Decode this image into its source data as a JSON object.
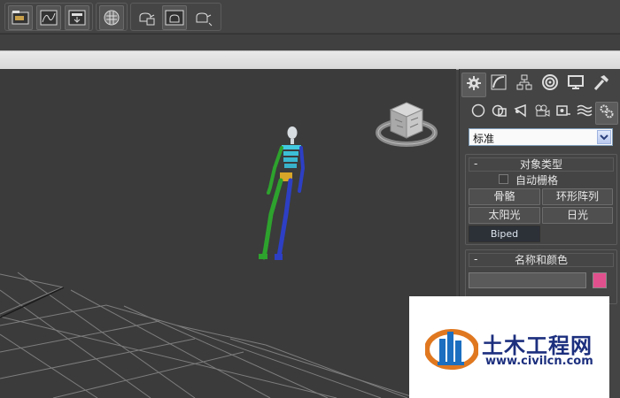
{
  "toolbar": {
    "groups": [
      {
        "icons": [
          "scene-explorer-icon",
          "curve-editor-icon",
          "schematic-view-icon"
        ]
      },
      {
        "icons": [
          "material-editor-icon"
        ]
      },
      {
        "icons": [
          "render-setup-icon",
          "rendered-frame-window-icon",
          "render-production-icon"
        ]
      }
    ]
  },
  "command_panel": {
    "tabs": [
      "create-tab",
      "modify-tab",
      "hierarchy-tab",
      "motion-tab",
      "display-tab",
      "utilities-tab"
    ],
    "subcategories": [
      "geometry",
      "shapes",
      "lights",
      "cameras",
      "helpers",
      "space-warps",
      "systems"
    ],
    "category": {
      "value": "标准"
    },
    "object_type": {
      "title": "对象类型",
      "collapse": "-",
      "auto_grid": "自动栅格",
      "buttons": [
        "骨骼",
        "环形阵列",
        "太阳光",
        "日光",
        "Biped"
      ]
    },
    "name_color": {
      "title": "名称和颜色",
      "collapse": "-",
      "name_value": "",
      "swatch_color": "#e0508c"
    }
  },
  "watermark": {
    "title": "土木工程网",
    "url": "www.civilcn.com"
  }
}
